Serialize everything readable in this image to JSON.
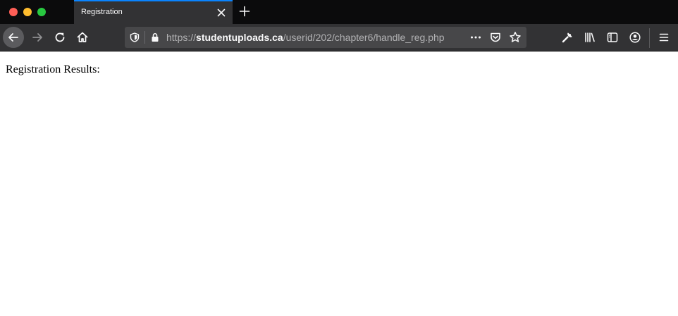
{
  "browser": {
    "tab": {
      "title": "Registration",
      "close_icon": "close-icon"
    },
    "new_tab_icon": "plus-icon",
    "traffic_lights": {
      "close_color": "#ff5f57",
      "minimize_color": "#febc2e",
      "zoom_color": "#28c840"
    },
    "accent_color": "#0a84ff",
    "nav": {
      "back_icon": "arrow-left-icon",
      "forward_icon": "arrow-right-icon",
      "reload_icon": "reload-icon",
      "home_icon": "home-icon"
    },
    "url": {
      "scheme": "https://",
      "host": "studentuploads.ca",
      "path": "/userid/202/chapter6/handle_reg.php",
      "icons": {
        "tracking": "shield-icon",
        "security": "lock-icon",
        "more": "more-icon",
        "pocket": "pocket-icon",
        "bookmark": "star-icon"
      }
    },
    "toolbar_icons": {
      "tools": "wrench-icon",
      "library": "library-icon",
      "sidebar": "sidebar-icon",
      "account": "account-icon",
      "menu": "menu-icon"
    }
  },
  "page": {
    "text": "Registration Results:"
  }
}
